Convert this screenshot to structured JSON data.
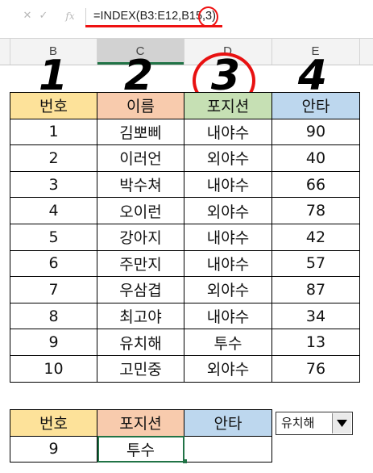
{
  "formula_bar": {
    "cancel_icon": "✕",
    "enter_icon": "✓",
    "function_icon": "fx",
    "formula": "=INDEX(B3:E12,B15,3)"
  },
  "column_headers": [
    "B",
    "C",
    "D",
    "E"
  ],
  "big_numbers": [
    "1",
    "2",
    "3",
    "4"
  ],
  "table": {
    "headers": [
      "번호",
      "이름",
      "포지션",
      "안타"
    ],
    "rows": [
      [
        "1",
        "김뽀삐",
        "내야수",
        "90"
      ],
      [
        "2",
        "이러언",
        "외야수",
        "40"
      ],
      [
        "3",
        "박수쳐",
        "내야수",
        "66"
      ],
      [
        "4",
        "오이런",
        "외야수",
        "78"
      ],
      [
        "5",
        "강아지",
        "내야수",
        "42"
      ],
      [
        "6",
        "주만지",
        "내야수",
        "57"
      ],
      [
        "7",
        "우삼겹",
        "외야수",
        "87"
      ],
      [
        "8",
        "최고야",
        "내야수",
        "34"
      ],
      [
        "9",
        "유치해",
        "투수",
        "13"
      ],
      [
        "10",
        "고민중",
        "외야수",
        "76"
      ]
    ]
  },
  "lookup": {
    "headers": [
      "번호",
      "포지션",
      "안타"
    ],
    "values": [
      "9",
      "투수",
      ""
    ]
  },
  "dropdown": {
    "value": "유치해",
    "arrow_icon": "triangle-down-icon"
  },
  "colors": {
    "header_no": "#fde29a",
    "header_name": "#f8cbad",
    "header_position": "#c6e0b4",
    "header_hits": "#bdd7ee",
    "annotation_red": "#e81111",
    "excel_green": "#217346"
  }
}
